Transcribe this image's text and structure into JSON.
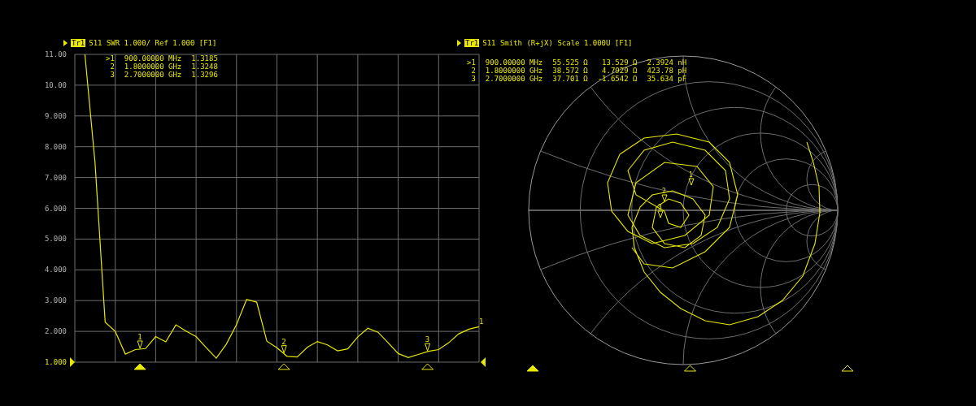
{
  "swr_panel": {
    "trace": "Tr1",
    "title": "S11 SWR 1.000/ Ref 1.000 [F1]",
    "trace_end_label": "1",
    "markers": [
      {
        "number": ">1",
        "label": "1",
        "frequency": "900.00000 MHz",
        "value": "1.3185",
        "active": true
      },
      {
        "number": "2",
        "label": "2",
        "frequency": "1.8000000 GHz",
        "value": "1.3248",
        "active": false
      },
      {
        "number": "3",
        "label": "3",
        "frequency": "2.7000000 GHz",
        "value": "1.3296",
        "active": false
      }
    ],
    "chart_data": {
      "type": "line",
      "grid": true,
      "ylim": [
        1,
        11
      ],
      "yticks": [
        {
          "value": 11,
          "label": "11.00"
        },
        {
          "value": 10,
          "label": "10.00"
        },
        {
          "value": 9,
          "label": "9.000"
        },
        {
          "value": 8,
          "label": "8.000"
        },
        {
          "value": 7,
          "label": "7.000"
        },
        {
          "value": 6,
          "label": "6.000"
        },
        {
          "value": 5,
          "label": "5.000"
        },
        {
          "value": 4,
          "label": "4.000"
        },
        {
          "value": 3,
          "label": "3.000"
        },
        {
          "value": 2,
          "label": "2.000"
        },
        {
          "value": 1,
          "label": "1.000"
        }
      ],
      "categories": [
        null,
        null,
        null,
        null,
        null,
        null,
        null,
        null,
        null,
        null,
        null,
        null,
        null,
        null,
        null,
        null,
        null,
        null,
        null,
        null,
        null,
        null,
        null,
        null,
        null,
        null,
        null,
        null,
        null,
        null,
        null,
        null,
        null,
        null,
        null,
        null,
        null,
        null,
        null,
        null,
        null
      ],
      "series": [
        {
          "color": "#e8e800",
          "values": [
            null,
            11,
            7.5,
            2.3,
            2.0,
            1.26,
            1.41,
            1.44,
            1.83,
            1.66,
            2.21,
            2.01,
            1.83,
            1.47,
            1.13,
            1.59,
            2.22,
            3.04,
            2.95,
            1.68,
            1.47,
            1.19,
            1.17,
            1.48,
            1.67,
            1.56,
            1.37,
            1.43,
            1.82,
            2.1,
            1.97,
            1.63,
            1.28,
            1.15,
            1.25,
            1.35,
            1.41,
            1.63,
            1.92,
            2.07,
            2.15
          ]
        }
      ]
    }
  },
  "smith_panel": {
    "trace": "Tr1",
    "title": "S11 Smith (R+jX) Scale 1.000U [F1]",
    "markers": [
      {
        "number": ">1",
        "label": "1",
        "frequency": "900.00000 MHz",
        "resistance": "55.525 Ω",
        "reactance": "13.529 Ω",
        "equivalent": "2.3924 nH",
        "active": true
      },
      {
        "number": "2",
        "label": "2",
        "frequency": "1.8000000 GHz",
        "resistance": "38.572 Ω",
        "reactance": "4.7929 Ω",
        "equivalent": "423.78 pH",
        "active": false
      },
      {
        "number": "3",
        "label": "3",
        "frequency": "2.7000000 GHz",
        "resistance": "37.701 Ω",
        "reactance": "-1.6542 Ω",
        "equivalent": "35.634 pF",
        "active": false
      }
    ]
  }
}
